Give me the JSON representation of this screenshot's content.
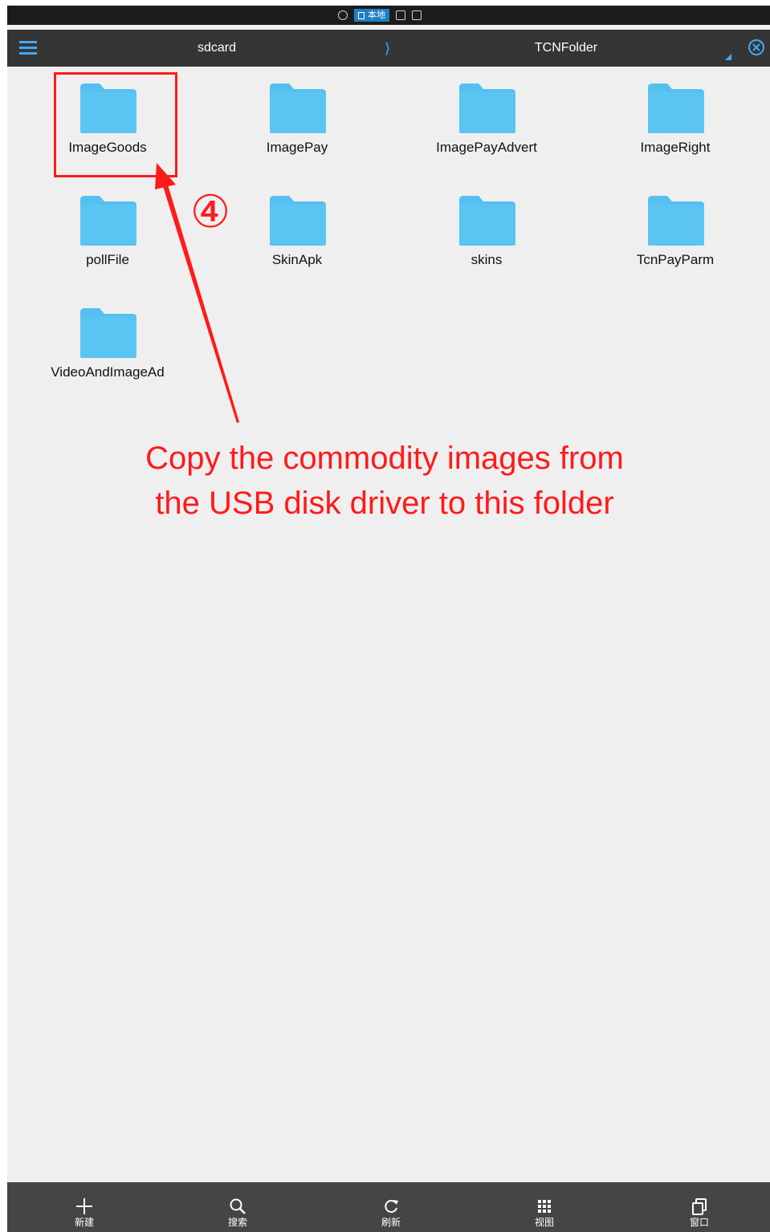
{
  "status_bar": {
    "local_tab_label": "本地"
  },
  "path_bar": {
    "breadcrumbs": [
      "sdcard",
      "TCNFolder"
    ],
    "separator": "⟩"
  },
  "folders": [
    {
      "name": "ImageGoods"
    },
    {
      "name": "ImagePay"
    },
    {
      "name": "ImagePayAdvert"
    },
    {
      "name": "ImageRight"
    },
    {
      "name": "pollFile"
    },
    {
      "name": "SkinApk"
    },
    {
      "name": "skins"
    },
    {
      "name": "TcnPayParm"
    },
    {
      "name": "VideoAndImageAd"
    }
  ],
  "annotation": {
    "step_number": "④",
    "caption_line1": "Copy the commodity images from",
    "caption_line2": "the USB disk driver to this folder",
    "color": "#ff1a1a"
  },
  "toolbar": {
    "items": [
      {
        "label": "新建",
        "icon": "plus-icon"
      },
      {
        "label": "搜索",
        "icon": "search-icon"
      },
      {
        "label": "刷新",
        "icon": "refresh-icon"
      },
      {
        "label": "视图",
        "icon": "grid-icon"
      },
      {
        "label": "窗口",
        "icon": "windows-icon"
      }
    ]
  },
  "colors": {
    "accent": "#3fa9f5",
    "folder": "#55c0f0",
    "background": "#efefef",
    "path_bar": "#353535",
    "toolbar": "#454545"
  }
}
